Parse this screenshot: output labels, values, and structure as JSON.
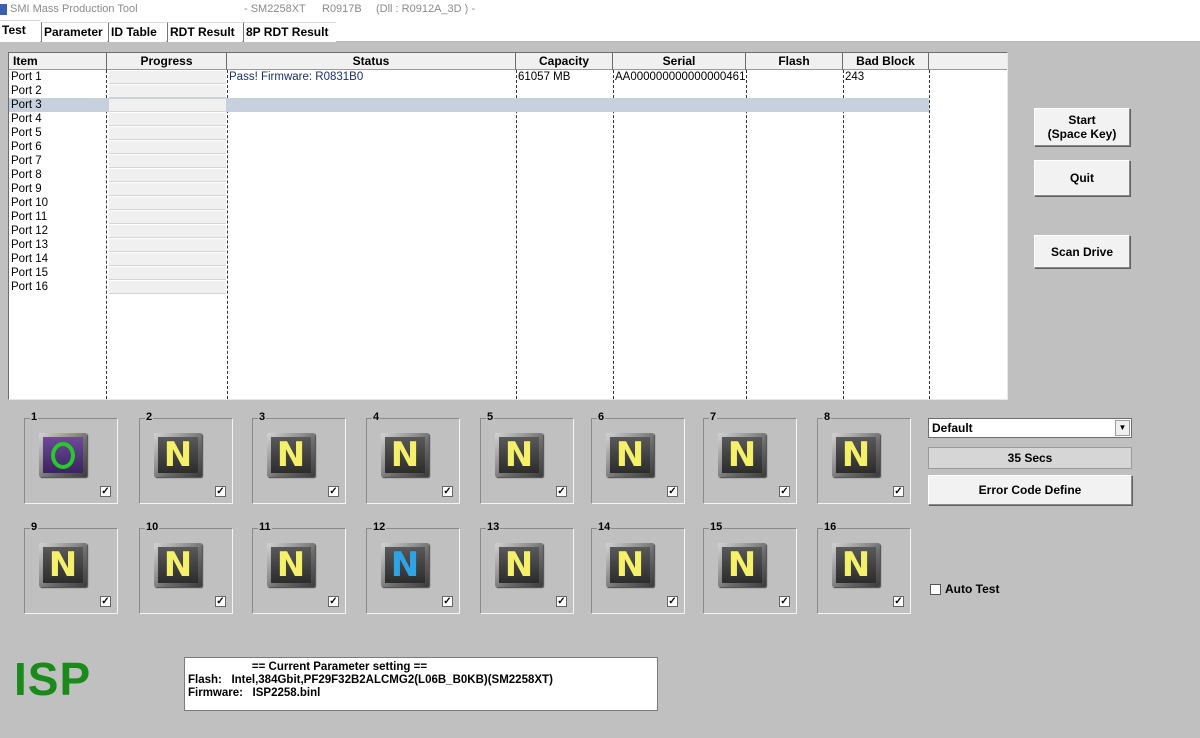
{
  "window": {
    "app_title": "SMI Mass Production Tool",
    "model": "- SM2258XT",
    "version": "R0917B",
    "dll": "(Dll : R0912A_3D ) -"
  },
  "tabs": [
    {
      "label": "Test",
      "active": true
    },
    {
      "label": "Parameter",
      "active": false
    },
    {
      "label": "ID Table",
      "active": false
    },
    {
      "label": "RDT Result",
      "active": false
    },
    {
      "label": "8P RDT Result",
      "active": false
    }
  ],
  "table": {
    "columns": [
      "Item",
      "Progress",
      "Status",
      "Capacity",
      "Serial",
      "Flash",
      "Bad Block"
    ],
    "selected_row": 2,
    "rows": [
      {
        "item": "Port 1",
        "status": "Pass! Firmware: R0831B0",
        "capacity": "61057 MB",
        "serial": "AA000000000000000461",
        "flash": "",
        "bad_block": "243"
      },
      {
        "item": "Port 2",
        "status": "",
        "capacity": "",
        "serial": "",
        "flash": "",
        "bad_block": ""
      },
      {
        "item": "Port 3",
        "status": "",
        "capacity": "",
        "serial": "",
        "flash": "",
        "bad_block": ""
      },
      {
        "item": "Port 4",
        "status": "",
        "capacity": "",
        "serial": "",
        "flash": "",
        "bad_block": ""
      },
      {
        "item": "Port 5",
        "status": "",
        "capacity": "",
        "serial": "",
        "flash": "",
        "bad_block": ""
      },
      {
        "item": "Port 6",
        "status": "",
        "capacity": "",
        "serial": "",
        "flash": "",
        "bad_block": ""
      },
      {
        "item": "Port 7",
        "status": "",
        "capacity": "",
        "serial": "",
        "flash": "",
        "bad_block": ""
      },
      {
        "item": "Port 8",
        "status": "",
        "capacity": "",
        "serial": "",
        "flash": "",
        "bad_block": ""
      },
      {
        "item": "Port 9",
        "status": "",
        "capacity": "",
        "serial": "",
        "flash": "",
        "bad_block": ""
      },
      {
        "item": "Port 10",
        "status": "",
        "capacity": "",
        "serial": "",
        "flash": "",
        "bad_block": ""
      },
      {
        "item": "Port 11",
        "status": "",
        "capacity": "",
        "serial": "",
        "flash": "",
        "bad_block": ""
      },
      {
        "item": "Port 12",
        "status": "",
        "capacity": "",
        "serial": "",
        "flash": "",
        "bad_block": ""
      },
      {
        "item": "Port 13",
        "status": "",
        "capacity": "",
        "serial": "",
        "flash": "",
        "bad_block": ""
      },
      {
        "item": "Port 14",
        "status": "",
        "capacity": "",
        "serial": "",
        "flash": "",
        "bad_block": ""
      },
      {
        "item": "Port 15",
        "status": "",
        "capacity": "",
        "serial": "",
        "flash": "",
        "bad_block": ""
      },
      {
        "item": "Port 16",
        "status": "",
        "capacity": "",
        "serial": "",
        "flash": "",
        "bad_block": ""
      }
    ]
  },
  "buttons": {
    "start_line1": "Start",
    "start_line2": "(Space Key)",
    "quit": "Quit",
    "scan": "Scan Drive",
    "error_code": "Error Code Define"
  },
  "ports": [
    {
      "num": "1",
      "letter": "O",
      "state": "pass",
      "color": "#29c929",
      "checked": true
    },
    {
      "num": "2",
      "letter": "N",
      "state": "idle",
      "color": "#f4f06a",
      "checked": true
    },
    {
      "num": "3",
      "letter": "N",
      "state": "idle",
      "color": "#f4f06a",
      "checked": true
    },
    {
      "num": "4",
      "letter": "N",
      "state": "idle",
      "color": "#f4f06a",
      "checked": true
    },
    {
      "num": "5",
      "letter": "N",
      "state": "idle",
      "color": "#f4f06a",
      "checked": true
    },
    {
      "num": "6",
      "letter": "N",
      "state": "idle",
      "color": "#f4f06a",
      "checked": true
    },
    {
      "num": "7",
      "letter": "N",
      "state": "idle",
      "color": "#f4f06a",
      "checked": true
    },
    {
      "num": "8",
      "letter": "N",
      "state": "idle",
      "color": "#f4f06a",
      "checked": true
    },
    {
      "num": "9",
      "letter": "N",
      "state": "idle",
      "color": "#f4f06a",
      "checked": true
    },
    {
      "num": "10",
      "letter": "N",
      "state": "idle",
      "color": "#f4f06a",
      "checked": true
    },
    {
      "num": "11",
      "letter": "N",
      "state": "idle",
      "color": "#f4f06a",
      "checked": true
    },
    {
      "num": "12",
      "letter": "N",
      "state": "idle",
      "color": "#2ea3e6",
      "checked": true
    },
    {
      "num": "13",
      "letter": "N",
      "state": "idle",
      "color": "#f4f06a",
      "checked": true
    },
    {
      "num": "14",
      "letter": "N",
      "state": "idle",
      "color": "#f4f06a",
      "checked": true
    },
    {
      "num": "15",
      "letter": "N",
      "state": "idle",
      "color": "#f4f06a",
      "checked": true
    },
    {
      "num": "16",
      "letter": "N",
      "state": "idle",
      "color": "#f4f06a",
      "checked": true
    }
  ],
  "checkbox_mark": "✓",
  "combo": {
    "selected": "Default",
    "arrow_icon": "▼"
  },
  "timer": "35 Secs",
  "auto_test": {
    "label": "Auto Test",
    "checked": false
  },
  "isp_label": "ISP",
  "param_box": {
    "heading": "                    == Current Parameter setting ==",
    "flash": "Flash:   Intel,384Gbit,PF29F32B2ALCMG2(L06B_B0KB)(SM2258XT)",
    "firmware": "Firmware:   ISP2258.binl"
  },
  "colors": {
    "window_bg": "#c0c0c0",
    "selected_row": "#c6d1dd",
    "isp_green": "#1a8a1a",
    "pass_green": "#29c929",
    "idle_yellow": "#f4f06a",
    "port12_blue": "#2ea3e6"
  }
}
